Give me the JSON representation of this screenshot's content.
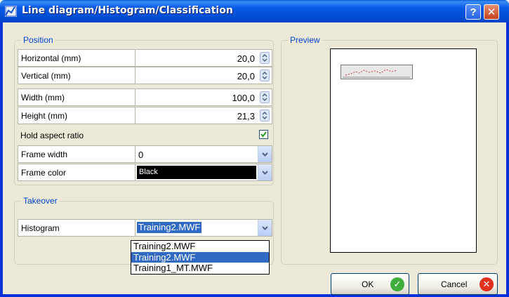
{
  "window": {
    "title": "Line diagram/Histogram/Classification",
    "help_label": "?",
    "close_label": "✕"
  },
  "position": {
    "group_label": "Position",
    "fields": [
      {
        "label": "Horizontal  (mm)",
        "value": "20,0"
      },
      {
        "label": "Vertical (mm)",
        "value": "20,0"
      },
      {
        "label": "Width (mm)",
        "value": "100,0"
      },
      {
        "label": "Height (mm)",
        "value": "21,3"
      }
    ],
    "hold_aspect_label": "Hold aspect ratio",
    "hold_aspect_checked": true,
    "frame_width_label": "Frame width",
    "frame_width_value": "0",
    "frame_color_label": "Frame color",
    "frame_color_value": "Black"
  },
  "takeover": {
    "group_label": "Takeover",
    "histogram_label": "Histogram",
    "histogram_value": "Training2.MWF",
    "options": [
      "Training2.MWF",
      "Training2.MWF",
      "Training1_MT.MWF"
    ],
    "selected_option_index": 1
  },
  "preview": {
    "group_label": "Preview"
  },
  "buttons": {
    "ok_label": "OK",
    "cancel_label": "Cancel"
  },
  "colors": {
    "title_bar": "#0758e6",
    "group_label": "#0046d5",
    "selection": "#316ac5",
    "ok_icon": "#3fae3f",
    "cancel_icon": "#e0301e"
  }
}
